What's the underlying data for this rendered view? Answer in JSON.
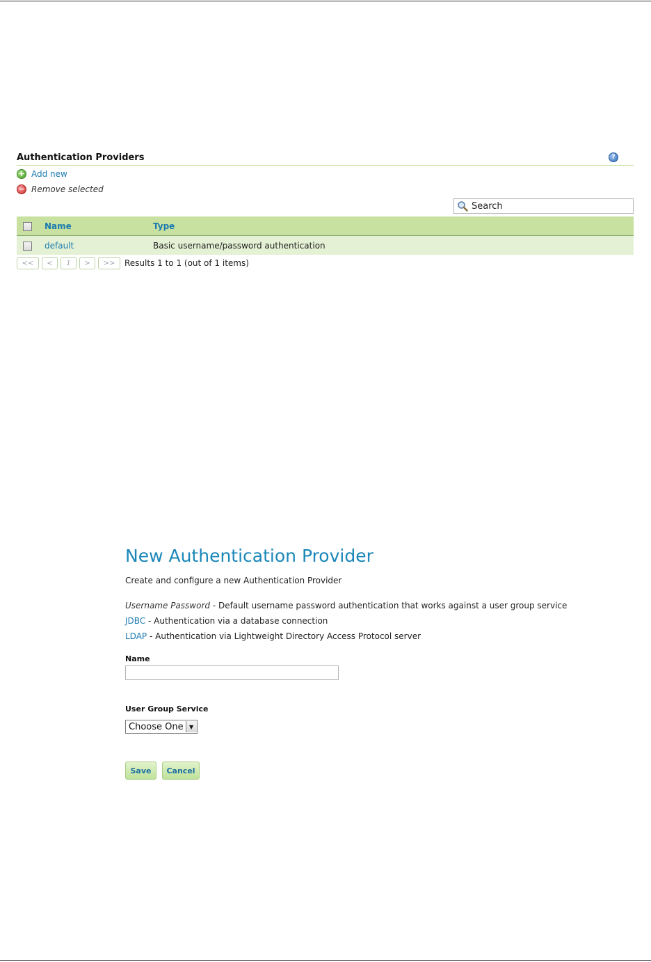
{
  "providers_panel": {
    "title": "Authentication Providers",
    "help_glyph": "?",
    "add_new": "Add new",
    "remove_selected": "Remove selected",
    "search_placeholder": "Search",
    "columns": {
      "name": "Name",
      "type": "Type"
    },
    "rows": [
      {
        "name": "default",
        "type": "Basic username/password authentication"
      }
    ],
    "pager": {
      "first": "<<",
      "prev": "<",
      "current": "1",
      "next": ">",
      "last": ">>",
      "results": "Results 1 to 1 (out of 1 items)"
    }
  },
  "new_provider_form": {
    "title": "New Authentication Provider",
    "subtitle": "Create and configure a new Authentication Provider",
    "types": [
      {
        "name": "Username Password",
        "description": " - Default username password authentication that works against a user group service"
      },
      {
        "name": "JDBC",
        "description": " - Authentication via a database connection"
      },
      {
        "name": "LDAP",
        "description": " - Authentication via Lightweight Directory Access Protocol server"
      }
    ],
    "name_label": "Name",
    "name_value": "",
    "user_group_service_label": "User Group Service",
    "user_group_service_value": "Choose One",
    "save_label": "Save",
    "cancel_label": "Cancel"
  },
  "colors": {
    "link": "#1b7bb0",
    "title": "#1b87b8",
    "header_row": "#c8e1a0",
    "body_row": "#e4f1d4"
  },
  "icons": [
    "help-icon",
    "add-icon",
    "remove-icon",
    "search-icon",
    "dropdown-arrow-icon"
  ]
}
